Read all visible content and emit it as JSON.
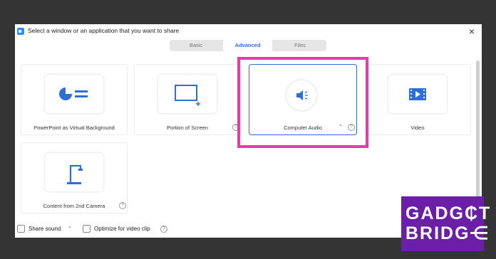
{
  "window": {
    "title": "Select a window or an application that you want to share",
    "close_glyph": "×"
  },
  "tabs": [
    {
      "label": "Basic",
      "active": false
    },
    {
      "label": "Advanced",
      "active": true
    },
    {
      "label": "Files",
      "active": false
    }
  ],
  "tiles": [
    {
      "label": "PowerPoint as Virtual Background",
      "icon": "powerpoint-background-icon",
      "help": false
    },
    {
      "label": "Portion of Screen",
      "icon": "screen-portion-icon",
      "help": true
    },
    {
      "label": "Computer Audio",
      "icon": "speaker-icon",
      "help": true,
      "selected": true
    },
    {
      "label": "Video",
      "icon": "video-film-icon",
      "help": false
    },
    {
      "label": "Content from 2nd Camera",
      "icon": "document-camera-icon",
      "help": true
    }
  ],
  "help_glyph": "?",
  "caret_glyph": "⌄",
  "bottom": {
    "share_sound": {
      "label": "Share sound",
      "checked": false
    },
    "optimize": {
      "label": "Optimize for video clip",
      "checked": false
    }
  },
  "watermark": {
    "line1": "GADG₵T",
    "line2": "BRIDG⋲"
  },
  "colors": {
    "accent": "#2d8cff",
    "highlight": "#e43ea4",
    "watermark_bg": "#6b1fa8",
    "backdrop": "#343434"
  }
}
